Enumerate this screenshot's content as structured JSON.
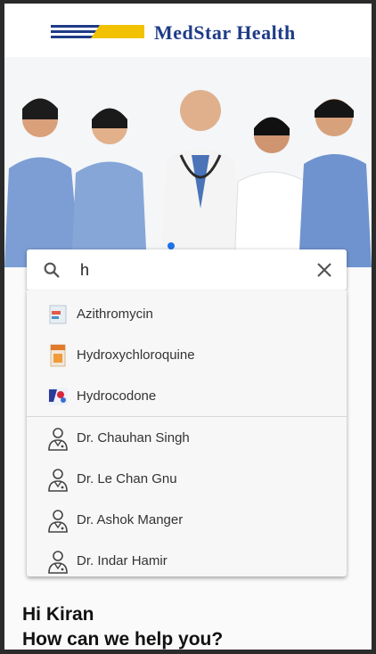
{
  "brand": {
    "name": "MedStar Health",
    "colors": {
      "navy": "#1f3b87",
      "gold": "#f2c200"
    }
  },
  "hero": {
    "image": "doctors-group-photo",
    "carousel_active_color": "#1e73e8"
  },
  "search": {
    "value": "h",
    "search_icon": "search-icon",
    "clear_icon": "close-icon"
  },
  "suggestions": {
    "medicines": [
      {
        "label": "Azithromycin",
        "icon": "medicine-box-icon"
      },
      {
        "label": "Hydroxychloroquine",
        "icon": "medicine-box-icon"
      },
      {
        "label": "Hydrocodone",
        "icon": "medicine-box-icon"
      }
    ],
    "doctors": [
      {
        "label": "Dr. Chauhan Singh",
        "icon": "doctor-icon"
      },
      {
        "label": "Dr. Le Chan Gnu",
        "icon": "doctor-icon"
      },
      {
        "label": "Dr. Ashok Manger",
        "icon": "doctor-icon"
      },
      {
        "label": "Dr. Indar Hamir",
        "icon": "doctor-icon"
      }
    ]
  },
  "greeting": {
    "line1": "Hi Kiran",
    "line2": "How can we help you?"
  }
}
